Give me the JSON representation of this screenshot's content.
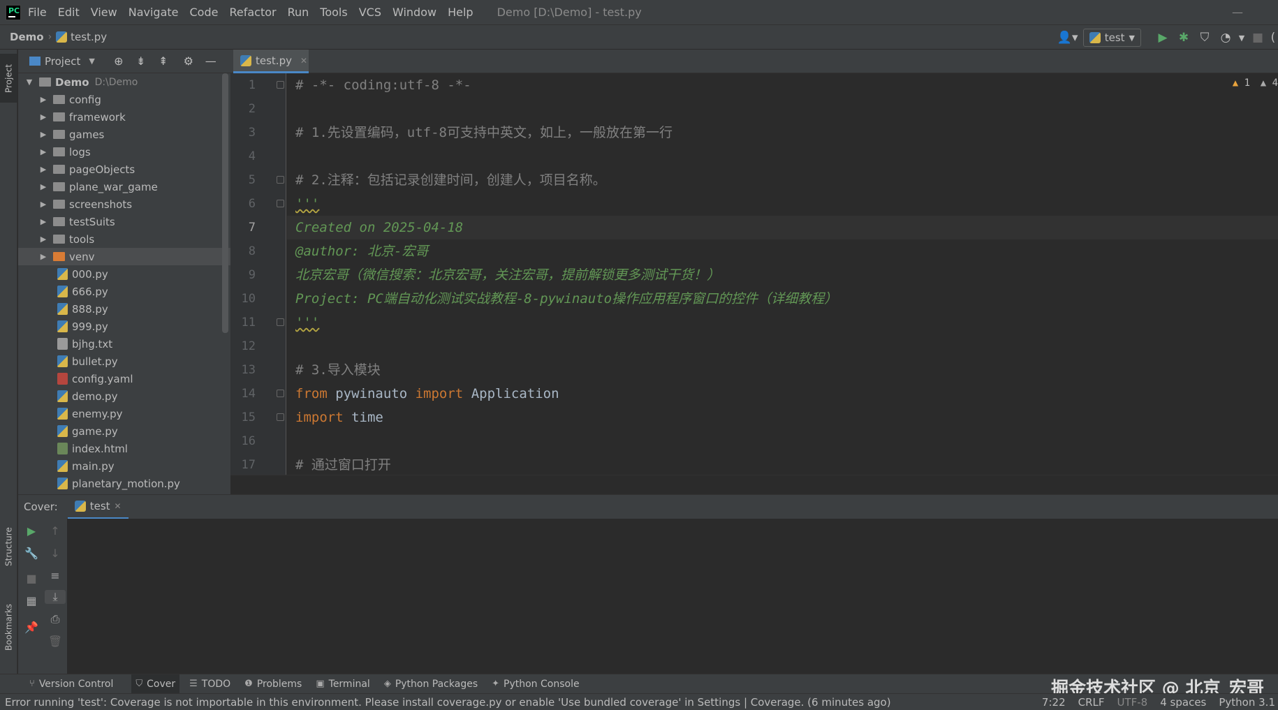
{
  "menubar": {
    "items": [
      "File",
      "Edit",
      "View",
      "Navigate",
      "Code",
      "Refactor",
      "Run",
      "Tools",
      "VCS",
      "Window",
      "Help"
    ],
    "window_title": "Demo [D:\\Demo] - test.py"
  },
  "navbar": {
    "project": "Demo",
    "file": "test.py",
    "run_config": "test"
  },
  "left_strip": {
    "project_tab": "Project",
    "structure_tab": "Structure",
    "bookmarks_tab": "Bookmarks"
  },
  "project_panel": {
    "title": "Project",
    "root": {
      "name": "Demo",
      "path": "D:\\Demo"
    },
    "folders": [
      "config",
      "framework",
      "games",
      "logs",
      "pageObjects",
      "plane_war_game",
      "screenshots",
      "testSuits",
      "tools",
      "venv"
    ],
    "files": [
      "000.py",
      "666.py",
      "888.py",
      "999.py",
      "bjhg.txt",
      "bullet.py",
      "config.yaml",
      "demo.py",
      "enemy.py",
      "game.py",
      "index.html",
      "main.py",
      "planetary_motion.py"
    ],
    "selected": "venv"
  },
  "editor": {
    "tab": "test.py",
    "current_line": 7,
    "warnings_a": "1",
    "warnings_b": "4",
    "lines": [
      "# -*- coding:utf-8 -*-",
      "",
      "# 1.先设置编码，utf-8可支持中英文，如上，一般放在第一行",
      "",
      "# 2.注释：包括记录创建时间，创建人，项目名称。",
      "'''",
      "Created on 2025-04-18",
      "@author: 北京-宏哥",
      "北京宏哥（微信搜索：北京宏哥，关注宏哥，提前解锁更多测试干货！）",
      "Project: PC端自动化测试实战教程-8-pywinauto操作应用程序窗口的控件（详细教程）",
      "'''",
      "",
      "# 3.导入模块",
      "from pywinauto import Application",
      "import time",
      "",
      "# 通过窗口打开"
    ],
    "line_numbers": [
      "1",
      "2",
      "3",
      "4",
      "5",
      "6",
      "7",
      "8",
      "9",
      "10",
      "11",
      "12",
      "13",
      "14",
      "15",
      "16",
      "17"
    ]
  },
  "cover_panel": {
    "label": "Cover:",
    "tab": "test"
  },
  "bottom_tools": [
    "Version Control",
    "Cover",
    "TODO",
    "Problems",
    "Terminal",
    "Python Packages",
    "Python Console"
  ],
  "watermark": "掘金技术社区 @ 北京_宏哥",
  "status": {
    "message": "Error running 'test': Coverage is not importable in this environment. Please install coverage.py or enable 'Use bundled coverage' in Settings | Coverage. (6 minutes ago)",
    "position": "7:22",
    "line_sep": "CRLF",
    "encoding": "UTF-8",
    "indent": "4 spaces",
    "interpreter": "Python 3.1"
  }
}
